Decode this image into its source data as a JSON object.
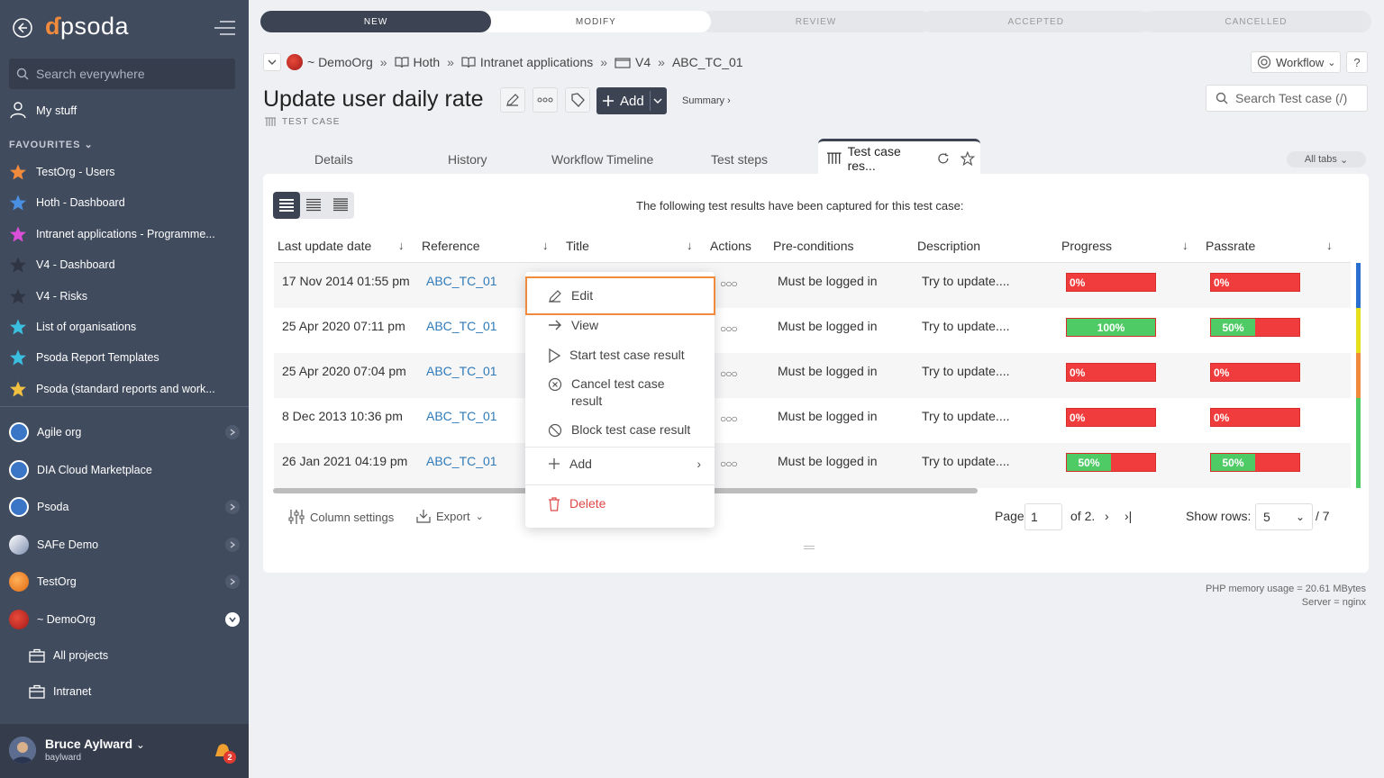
{
  "sidebar": {
    "logo": "psoda",
    "search_placeholder": "Search everywhere",
    "my_stuff": "My stuff",
    "favourites_label": "FAVOURITES",
    "favourites": [
      {
        "label": "TestOrg - Users",
        "star_color": "#f08a3c"
      },
      {
        "label": "Hoth - Dashboard",
        "star_color": "#4a90e2"
      },
      {
        "label": "Intranet applications - Programme...",
        "star_color": "#d94fd8"
      },
      {
        "label": "V4 - Dashboard",
        "star_color": "#2f3543"
      },
      {
        "label": "V4 - Risks",
        "star_color": "#2f3543"
      },
      {
        "label": "List of organisations",
        "star_color": "#3bbfe0"
      },
      {
        "label": "Psoda Report Templates",
        "star_color": "#3bbfe0"
      },
      {
        "label": "Psoda (standard reports and work...",
        "star_color": "#f0c040"
      }
    ],
    "orgs": [
      {
        "label": "Agile org",
        "chevron": "right"
      },
      {
        "label": "DIA Cloud Marketplace",
        "chevron": "none"
      },
      {
        "label": "Psoda",
        "chevron": "right"
      },
      {
        "label": "SAFe Demo",
        "chevron": "right"
      },
      {
        "label": "TestOrg",
        "chevron": "right"
      },
      {
        "label": "~ DemoOrg",
        "chevron": "down"
      }
    ],
    "sub_items": [
      "All projects",
      "Intranet"
    ],
    "user": {
      "name": "Bruce Aylward",
      "login": "baylward",
      "notifications": "2"
    }
  },
  "workflow_stages": [
    "NEW",
    "MODIFY",
    "REVIEW",
    "ACCEPTED",
    "CANCELLED"
  ],
  "breadcrumb": [
    "~ DemoOrg",
    "Hoth",
    "Intranet applications",
    "V4",
    "ABC_TC_01"
  ],
  "workflow_button": "Workflow",
  "help": "?",
  "page_title": "Update user daily rate",
  "add_button": "Add",
  "summary_link": "Summary ›",
  "subtitle": "TEST CASE",
  "search_placeholder": "Search Test case (/)",
  "tabs": [
    "Details",
    "History",
    "Workflow Timeline",
    "Test steps"
  ],
  "active_tab": "Test case res...",
  "all_tabs": "All tabs",
  "table": {
    "caption": "The following test results have been captured for this test case:",
    "columns": [
      "Last update date",
      "Reference",
      "Title",
      "Actions",
      "Pre-conditions",
      "Description",
      "Progress",
      "Passrate"
    ],
    "rows": [
      {
        "date": "17 Nov 2014 01:55 pm",
        "ref": "ABC_TC_01",
        "pre": "Must be logged in",
        "desc": "Try to update....",
        "progress": 0,
        "progress_label": "0%",
        "passrate": 0,
        "passrate_label": "0%",
        "strip": "#2a6fd0"
      },
      {
        "date": "25 Apr 2020 07:11 pm",
        "ref": "ABC_TC_01",
        "pre": "Must be logged in",
        "desc": "Try to update....",
        "progress": 100,
        "progress_label": "100%",
        "passrate": 50,
        "passrate_label": "50%",
        "strip": "#e6e01b"
      },
      {
        "date": "25 Apr 2020 07:04 pm",
        "ref": "ABC_TC_01",
        "pre": "Must be logged in",
        "desc": "Try to update....",
        "progress": 0,
        "progress_label": "0%",
        "passrate": 0,
        "passrate_label": "0%",
        "strip": "#f08a3c"
      },
      {
        "date": "8 Dec 2013 10:36 pm",
        "ref": "ABC_TC_01",
        "pre": "Must be logged in",
        "desc": "Try to update....",
        "progress": 0,
        "progress_label": "0%",
        "passrate": 0,
        "passrate_label": "0%",
        "strip": "#4fcb65"
      },
      {
        "date": "26 Jan 2021 04:19 pm",
        "ref": "ABC_TC_01",
        "pre": "Must be logged in",
        "desc": "Try to update....",
        "progress": 50,
        "progress_label": "50%",
        "passrate": 50,
        "passrate_label": "50%",
        "strip": "#4fcb65"
      }
    ]
  },
  "footer": {
    "column_settings": "Column settings",
    "export": "Export",
    "page_label": "Page",
    "page_value": "1",
    "of_pages": "of 2.",
    "show_rows": "Show rows:",
    "rows_value": "5",
    "total": "/ 7"
  },
  "context_menu": [
    "Edit",
    "View",
    "Start test case result",
    "Cancel test case result",
    "Block test case result",
    "Add",
    "Delete"
  ],
  "server_info": [
    "PHP memory usage = 20.61 MBytes",
    "Server = nginx"
  ]
}
